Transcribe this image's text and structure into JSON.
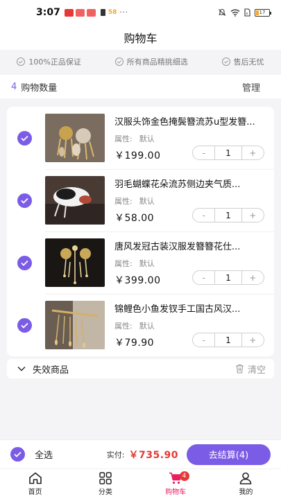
{
  "status_bar": {
    "time": "3:07",
    "app_badge": "58",
    "battery": "17"
  },
  "header": {
    "title": "购物车"
  },
  "guarantees": [
    "100%正品保证",
    "所有商品精挑细选",
    "售后无忧"
  ],
  "cart_header": {
    "count": "4",
    "count_label": "购物数量",
    "manage": "管理"
  },
  "items": [
    {
      "title": "汉服头饰金色掩鬓簪流苏u型发簪...",
      "attr_label": "属性:",
      "attr_value": "默认",
      "price": "￥199.00",
      "qty": "1",
      "checked": true,
      "thumb_colors": [
        "#8c7a6a",
        "#d8cab8",
        "#c8a24e"
      ]
    },
    {
      "title": "羽毛蝴蝶花朵流苏侧边夹气质...",
      "attr_label": "属性:",
      "attr_value": "默认",
      "price": "￥58.00",
      "qty": "1",
      "checked": true,
      "thumb_colors": [
        "#4a3a34",
        "#f2f2f2",
        "#b24a3a"
      ]
    },
    {
      "title": "唐风发冠古装汉服发簪簪花仕...",
      "attr_label": "属性:",
      "attr_value": "默认",
      "price": "￥399.00",
      "qty": "1",
      "checked": true,
      "thumb_colors": [
        "#1a1614",
        "#c9a85a",
        "#e6d29a"
      ]
    },
    {
      "title": "锦鲤色小鱼发钗手工国古风汉...",
      "attr_label": "属性:",
      "attr_value": "默认",
      "price": "￥79.90",
      "qty": "1",
      "checked": true,
      "thumb_colors": [
        "#6a5e52",
        "#c2b6a6",
        "#d4b06a"
      ]
    }
  ],
  "stepper": {
    "minus": "-",
    "plus": "+"
  },
  "invalid": {
    "label": "失效商品",
    "clear": "清空"
  },
  "checkout": {
    "select_all": "全选",
    "pay_label": "实付:",
    "total": "￥735.90",
    "button": "去结算(4)"
  },
  "tabs": [
    {
      "label": "首页",
      "icon": "home-icon"
    },
    {
      "label": "分类",
      "icon": "grid-icon"
    },
    {
      "label": "购物车",
      "icon": "cart-icon",
      "badge": "4",
      "active": true
    },
    {
      "label": "我的",
      "icon": "user-icon"
    }
  ],
  "colors": {
    "accent": "#7b5ce6",
    "price_red": "#e53935",
    "active_tab": "#e91e63"
  }
}
